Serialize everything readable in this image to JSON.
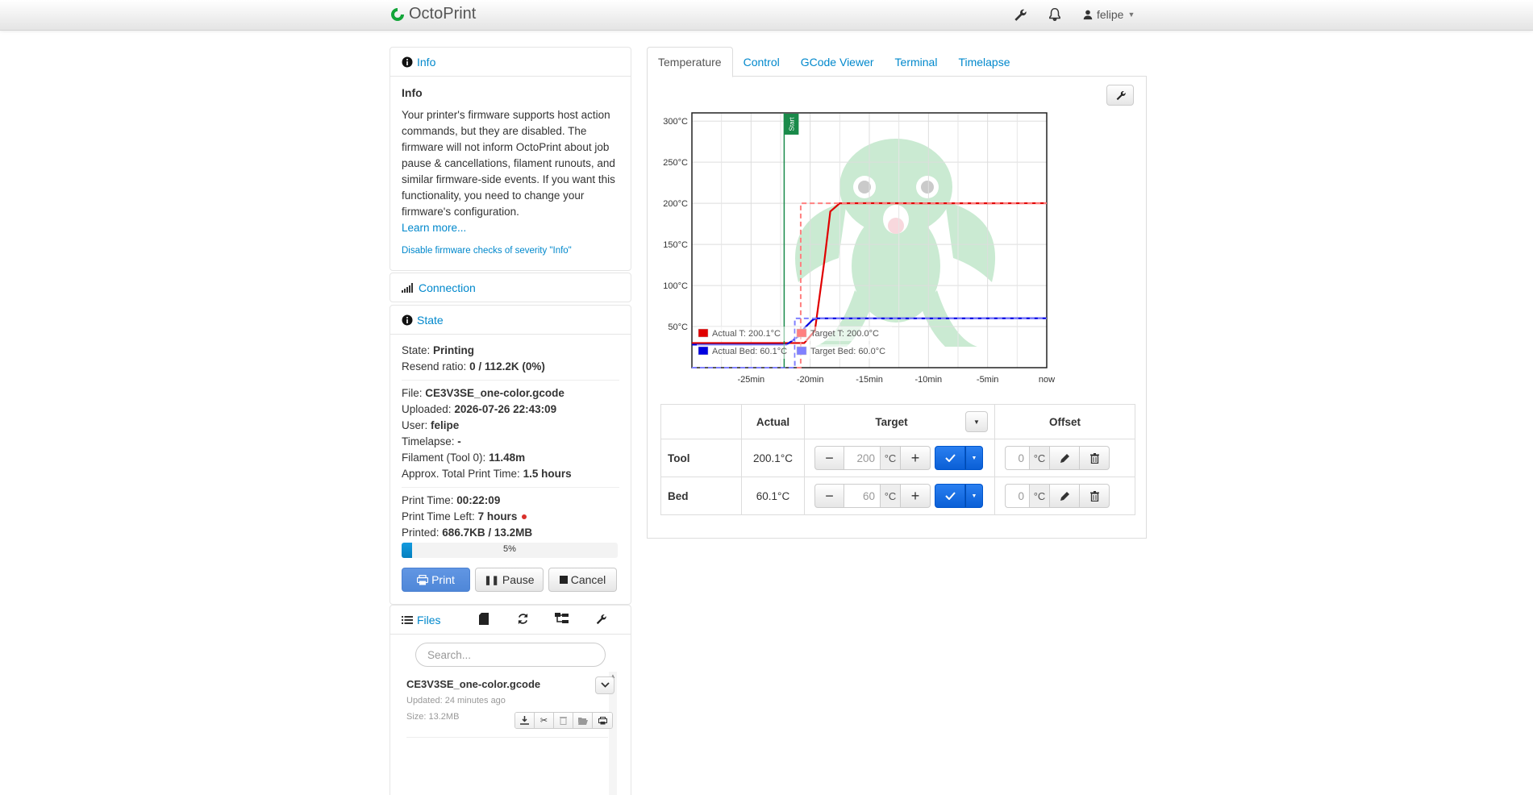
{
  "brand": {
    "name": "OctoPrint"
  },
  "navbar": {
    "user": "felipe"
  },
  "info_panel": {
    "heading": "Info",
    "title": "Info",
    "text": "Your printer's firmware supports host action commands, but they are disabled. The firmware will not inform OctoPrint about job pause & cancellations, filament runouts, and similar firmware-side events. If you want this functionality, you need to change your firmware's configuration.",
    "learn_more": "Learn more...",
    "disable_link": "Disable firmware checks of severity \"Info\""
  },
  "connection_panel": {
    "heading": "Connection"
  },
  "state_panel": {
    "heading": "State",
    "state_label": "State:",
    "state_value": "Printing",
    "resend_label": "Resend ratio:",
    "resend_value": "0 / 112.2K (0%)",
    "file_label": "File:",
    "file_value": "CE3V3SE_one-color.gcode",
    "uploaded_label": "Uploaded:",
    "uploaded_value": "2026-07-26 22:43:09",
    "user_label": "User:",
    "user_value": "felipe",
    "timelapse_label": "Timelapse:",
    "timelapse_value": "-",
    "filament_label": "Filament (Tool 0):",
    "filament_value": "11.48m",
    "approx_label": "Approx. Total Print Time:",
    "approx_value": "1.5 hours",
    "print_time_label": "Print Time:",
    "print_time_value": "00:22:09",
    "time_left_label": "Print Time Left:",
    "time_left_value": "7 hours",
    "printed_label": "Printed:",
    "printed_value": "686.7KB / 13.2MB",
    "progress_label": "5%",
    "progress_fraction": 0.05,
    "print_button": "Print",
    "pause_button": "Pause",
    "cancel_button": "Cancel"
  },
  "files_panel": {
    "heading": "Files",
    "search_placeholder": "Search...",
    "file": {
      "name": "CE3V3SE_one-color.gcode",
      "updated": "Updated: 24 minutes ago",
      "size": "Size: 13.2MB"
    }
  },
  "tabs": [
    "Temperature",
    "Control",
    "GCode Viewer",
    "Terminal",
    "Timelapse"
  ],
  "temperature_table": {
    "headers": {
      "actual": "Actual",
      "target": "Target",
      "offset": "Offset"
    },
    "rows": [
      {
        "label": "Tool",
        "actual": "200.1°C",
        "target": "200",
        "unit": "°C",
        "offset": "0"
      },
      {
        "label": "Bed",
        "actual": "60.1°C",
        "target": "60",
        "unit": "°C",
        "offset": "0"
      }
    ]
  },
  "colors": {
    "accent": "#0088cc",
    "actual_tool": "#e00000",
    "target_tool": "#ff8080",
    "actual_bed": "#0000e0",
    "target_bed": "#8080ff",
    "start_marker": "#1a8a4a"
  },
  "chart_data": {
    "type": "line",
    "x_tick_labels": [
      "-25min",
      "-20min",
      "-15min",
      "-10min",
      "-5min",
      "now"
    ],
    "y_tick_labels": [
      "300°C",
      "250°C",
      "200°C",
      "150°C",
      "100°C",
      "50°C"
    ],
    "xlim": [
      -30,
      0
    ],
    "ylim": [
      0,
      310
    ],
    "grid": true,
    "legend_position": "bottom-left",
    "marker": {
      "label": "Start",
      "x": -22.2
    },
    "series": [
      {
        "name": "Actual T: 200.1°C",
        "color": "#e00000",
        "dash": false,
        "x": [
          -30,
          -21.5,
          -20.5,
          -19.6,
          -18.8,
          -18.3,
          -17.5,
          -15,
          -10,
          -5,
          0
        ],
        "y": [
          30,
          30,
          30,
          45,
          130,
          190,
          200,
          200.1,
          200,
          200,
          200.1
        ]
      },
      {
        "name": "Target T: 200.0°C",
        "color": "#ff8080",
        "dash": true,
        "x": [
          -30,
          -20.8,
          -20.8,
          0
        ],
        "y": [
          0,
          0,
          200,
          200
        ]
      },
      {
        "name": "Actual Bed: 60.1°C",
        "color": "#0000e0",
        "dash": false,
        "x": [
          -30,
          -22,
          -21,
          -20.5,
          -19.8,
          -19.5,
          -18,
          -10,
          0
        ],
        "y": [
          28,
          28,
          38,
          48,
          58,
          60,
          60,
          60,
          60.1
        ]
      },
      {
        "name": "Target Bed: 60.0°C",
        "color": "#8080ff",
        "dash": true,
        "x": [
          -30,
          -21.3,
          -21.3,
          0
        ],
        "y": [
          0,
          0,
          60,
          60
        ]
      }
    ]
  }
}
